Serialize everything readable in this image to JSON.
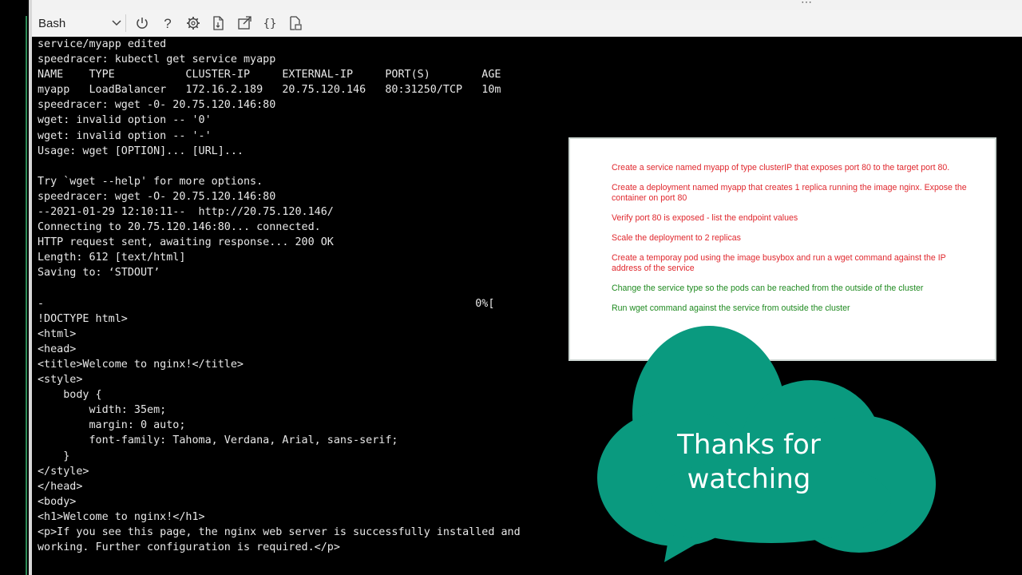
{
  "toolbar": {
    "shell": "Bash",
    "icons": [
      "chevron-down-icon",
      "power-icon",
      "help-icon",
      "settings-icon",
      "upload-download-icon",
      "open-editor-icon",
      "braces-icon",
      "web-preview-icon"
    ]
  },
  "terminal": {
    "lines": [
      "service/myapp edited",
      "speedracer: kubectl get service myapp",
      "NAME    TYPE           CLUSTER-IP     EXTERNAL-IP     PORT(S)        AGE",
      "myapp   LoadBalancer   172.16.2.189   20.75.120.146   80:31250/TCP   10m",
      "speedracer: wget -0- 20.75.120.146:80",
      "wget: invalid option -- '0'",
      "wget: invalid option -- '-'",
      "Usage: wget [OPTION]... [URL]...",
      "",
      "Try `wget --help' for more options.",
      "speedracer: wget -O- 20.75.120.146:80",
      "--2021-01-29 12:10:11--  http://20.75.120.146/",
      "Connecting to 20.75.120.146:80... connected.",
      "HTTP request sent, awaiting response... 200 OK",
      "Length: 612 [text/html]",
      "Saving to: ‘STDOUT’",
      "",
      "-                                                                   0%[",
      "!DOCTYPE html>",
      "<html>",
      "<head>",
      "<title>Welcome to nginx!</title>",
      "<style>",
      "    body {",
      "        width: 35em;",
      "        margin: 0 auto;",
      "        font-family: Tahoma, Verdana, Arial, sans-serif;",
      "    }",
      "</style>",
      "</head>",
      "<body>",
      "<h1>Welcome to nginx!</h1>",
      "<p>If you see this page, the nginx web server is successfully installed and",
      "working. Further configuration is required.</p>"
    ]
  },
  "tasks": [
    {
      "text": "Create a service named myapp of type clusterIP that exposes port 80 to the target port 80.",
      "color": "red"
    },
    {
      "text": "Create a deployment named myapp that creates 1 replica running the image nginx. Expose the container on port 80",
      "color": "red"
    },
    {
      "text": "Verify  port 80 is exposed - list the endpoint values",
      "color": "red"
    },
    {
      "text": "Scale the deployment to 2 replicas",
      "color": "red"
    },
    {
      "text": "Create a temporay pod using the image busybox and run a wget command against the IP address of the service",
      "color": "red"
    },
    {
      "text": "Change the service type so the pods can be reached from the outside of the cluster",
      "color": "green"
    },
    {
      "text": "Run wget command against the service from outside the cluster",
      "color": "green"
    }
  ],
  "overlay": {
    "line1": "Thanks for",
    "line2": "watching",
    "cloud_color": "#0a9a7f"
  }
}
